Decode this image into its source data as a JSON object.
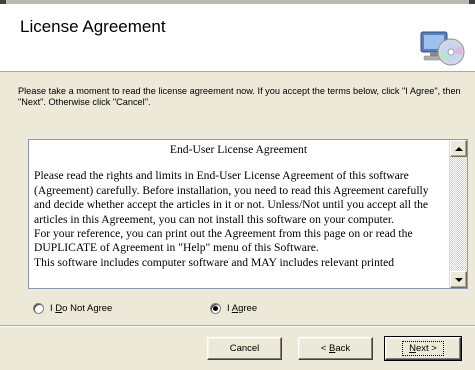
{
  "header": {
    "title": "License Agreement",
    "icon": "setup-computer-cd-icon"
  },
  "intro_text": "Please take a moment to read the license agreement now. If you accept the terms below, click \"I Agree\", then \"Next\". Otherwise click \"Cancel\".",
  "eula": {
    "heading": "End-User License Agreement",
    "paragraphs": [
      "Please read the rights and limits in End-User License Agreement of this software (Agreement) carefully. Before installation, you need to read this Agreement carefully and decide whether accept the articles in it or not. Unless/Not until you accept all the articles in this Agreement, you can not install this software on your computer.",
      "For your reference, you can print out the Agreement from this page on or read the DUPLICATE of Agreement in \"Help\" menu of this Software.",
      "This software includes computer software and MAY includes relevant printed"
    ]
  },
  "options": {
    "do_not_agree": {
      "pre": "I ",
      "accel": "D",
      "post": "o Not Agree",
      "checked": false
    },
    "agree": {
      "pre": "I ",
      "accel": "A",
      "post": "gree",
      "checked": true
    }
  },
  "buttons": {
    "cancel": "Cancel",
    "back": {
      "pre": "< ",
      "accel": "B",
      "post": "ack"
    },
    "next": {
      "pre": "",
      "accel": "N",
      "post": "ext >"
    }
  },
  "colors": {
    "dialog_bg": "#ece9d8",
    "header_bg": "#ffffff",
    "textbox_border": "#7f9db9"
  }
}
